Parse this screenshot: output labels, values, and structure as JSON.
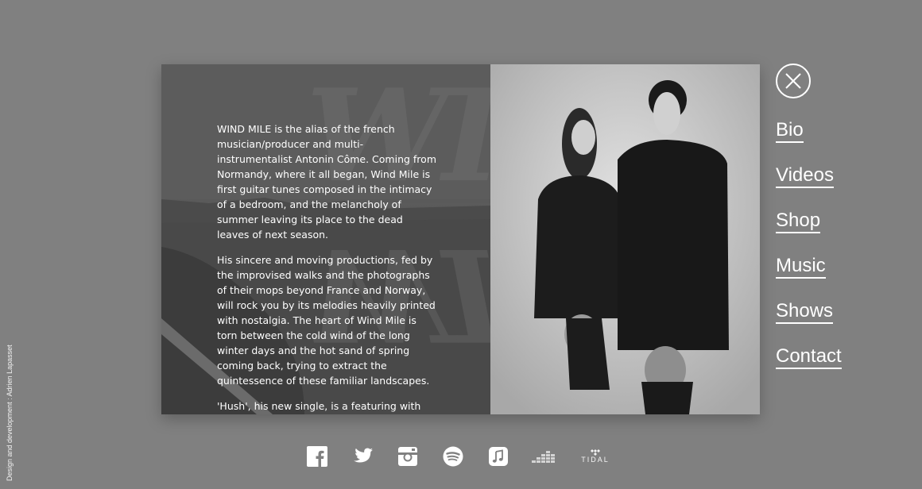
{
  "credit": "Design and development : Adrien Lapasset",
  "bio": {
    "watermark_top": "WI",
    "watermark_bottom": "WI",
    "paragraphs": [
      "WIND MILE is the alias of the french musician/producer and multi-instrumentalist Antonin Côme. Coming from Normandy, where it all began, Wind Mile is first guitar tunes composed in the intimacy of a bedroom, and the melancholy of summer leaving its place to the dead leaves of next season.",
      "His sincere and moving productions, fed by the improvised walks and the photographs of their mops beyond France and Norway, will rock you by its melodies heavily printed with nostalgia. The heart of Wind Mile is torn between the cold wind of the long winter days and the hot sand of spring coming back, trying to extract the quintessence of these familiar landscapes.",
      "'Hush', his new single, is a featuring with"
    ]
  },
  "nav": {
    "items": [
      "Bio",
      "Videos",
      "Shop",
      "Music",
      "Shows",
      "Contact"
    ]
  },
  "social": {
    "icons": [
      "facebook-icon",
      "twitter-icon",
      "instagram-icon",
      "spotify-icon",
      "itunes-icon",
      "deezer-icon",
      "tidal-icon"
    ],
    "tidal_label": "TIDAL"
  },
  "colors": {
    "background": "#808080",
    "text": "#ffffff"
  }
}
